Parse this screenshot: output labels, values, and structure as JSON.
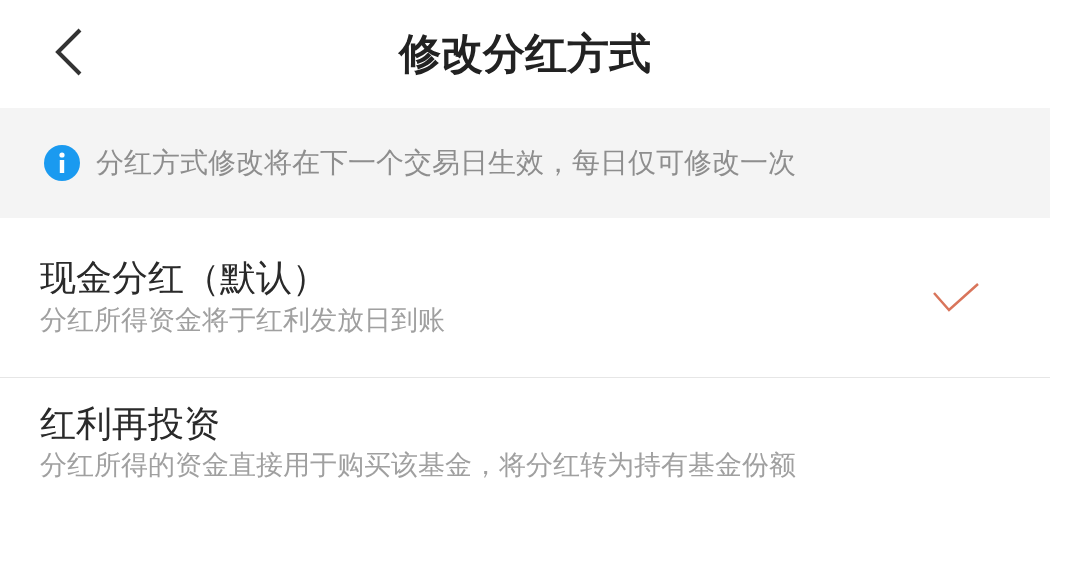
{
  "header": {
    "title": "修改分红方式"
  },
  "notice": {
    "text": "分红方式修改将在下一个交易日生效，每日仅可修改一次"
  },
  "options": [
    {
      "title": "现金分红（默认）",
      "description": "分红所得资金将于红利发放日到账",
      "selected": true
    },
    {
      "title": "红利再投资",
      "description": "分红所得的资金直接用于购买该基金，将分红转为持有基金份额",
      "selected": false
    }
  ]
}
